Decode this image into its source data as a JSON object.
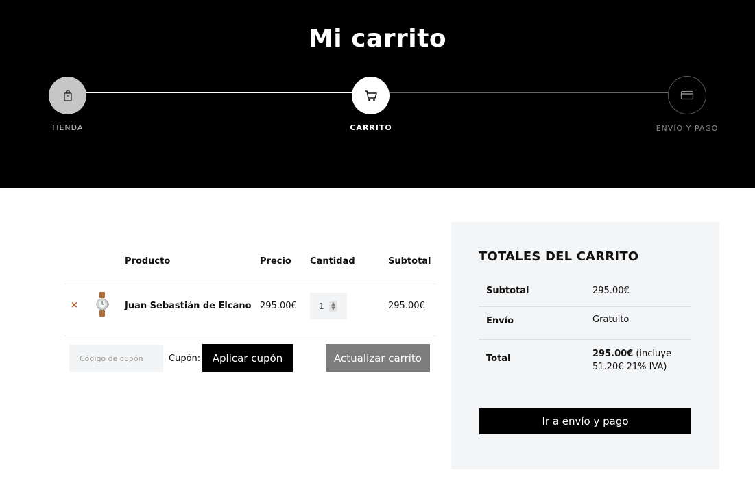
{
  "header": {
    "title": "Mi carrito",
    "steps": [
      {
        "label": "TIENDA",
        "icon": "shopping-bag-icon"
      },
      {
        "label": "CARRITO",
        "icon": "cart-icon"
      },
      {
        "label": "ENVÍO Y PAGO",
        "icon": "credit-card-icon"
      }
    ]
  },
  "cart": {
    "columns": {
      "product": "Producto",
      "price": "Precio",
      "quantity": "Cantidad",
      "subtotal": "Subtotal"
    },
    "items": [
      {
        "remove": "×",
        "name": "Juan Sebastián de Elcano",
        "price": "295.00€",
        "quantity": "1",
        "subtotal": "295.00€",
        "thumbnail_icon": "watch-icon"
      }
    ],
    "coupon": {
      "placeholder": "Código de cupón",
      "label": "Cupón:",
      "apply_button": "Aplicar cupón"
    },
    "update_button": "Actualizar carrito"
  },
  "totals": {
    "title": "TOTALES DEL CARRITO",
    "subtotal_label": "Subtotal",
    "subtotal_value": "295.00€",
    "shipping_label": "Envío",
    "shipping_value": "Gratuito",
    "total_label": "Total",
    "total_amount": "295.00€",
    "total_note": "(incluye 51.20€ 21% IVA)",
    "checkout_button": "Ir a envío y pago"
  },
  "colors": {
    "header_bg": "#000000",
    "accent_remove": "#c0562a",
    "panel_bg": "#f4f5f7",
    "update_button_bg": "#7d7d7d"
  }
}
